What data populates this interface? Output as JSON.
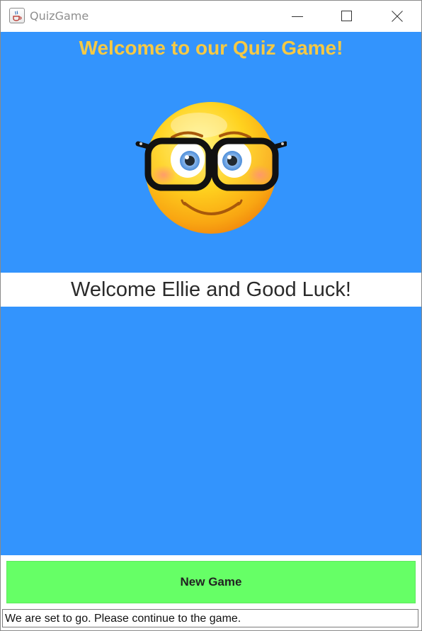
{
  "window": {
    "title": "QuizGame",
    "app_icon": "java-cup-icon",
    "controls": [
      "minimize-icon",
      "maximize-icon",
      "close-icon"
    ]
  },
  "main": {
    "headline": "Welcome to our Quiz Game!",
    "mascot_icon": "nerd-glasses-emoji",
    "welcome_message": "Welcome Ellie and Good Luck!"
  },
  "footer": {
    "new_game_label": "New Game",
    "status_text": "We are set to go. Please continue to the game."
  },
  "colors": {
    "content_background": "#3394fd",
    "headline": "#f6c944",
    "new_game_button": "#66ff66"
  }
}
